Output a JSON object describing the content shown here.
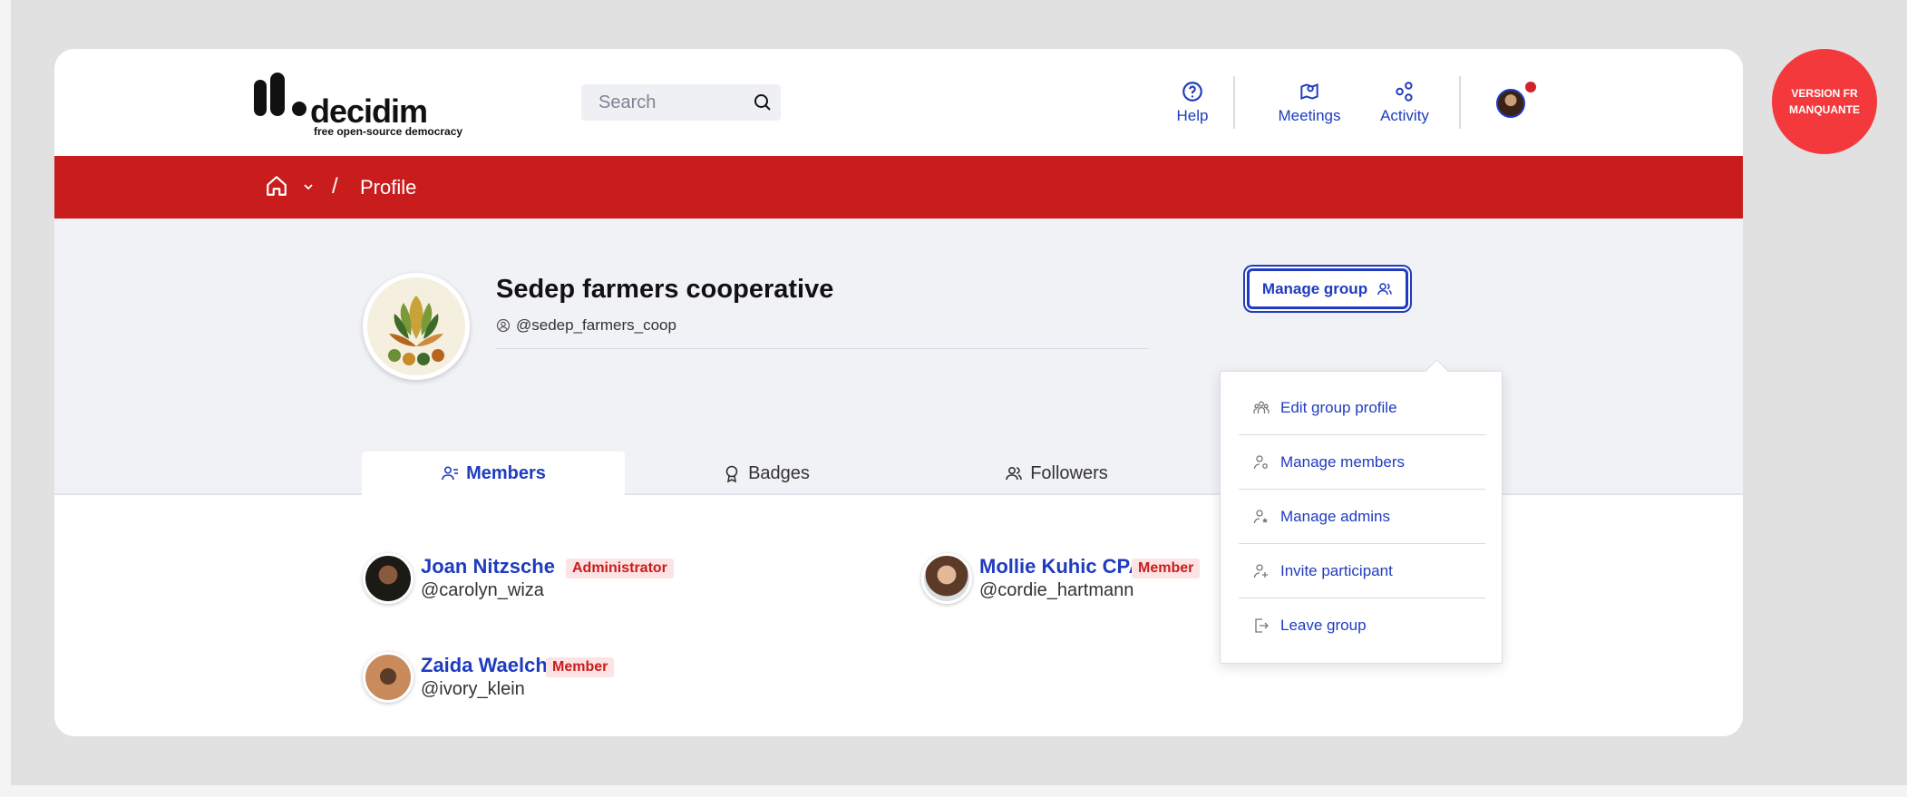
{
  "header": {
    "logo_word": "decidim",
    "logo_tagline": "free open-source democracy",
    "search_placeholder": "Search",
    "nav": [
      {
        "label": "Help",
        "icon": "help-circle-icon"
      },
      {
        "label": "Meetings",
        "icon": "map-pin-icon"
      },
      {
        "label": "Activity",
        "icon": "activity-icon"
      }
    ]
  },
  "breadcrumb": {
    "separator": "/",
    "current": "Profile"
  },
  "profile": {
    "name": "Sedep farmers cooperative",
    "nickname": "@sedep_farmers_coop",
    "manage_button": "Manage group"
  },
  "tabs": [
    {
      "label": "Members",
      "active": true
    },
    {
      "label": "Badges",
      "active": false
    },
    {
      "label": "Followers",
      "active": false
    }
  ],
  "members": [
    {
      "name": "Joan Nitzsche",
      "role": "Administrator",
      "nickname": "@carolyn_wiza"
    },
    {
      "name": "Mollie Kuhic CPA",
      "role": "Member",
      "nickname": "@cordie_hartmann"
    },
    {
      "name": "Zaida Waelchi",
      "role": "Member",
      "nickname": "@ivory_klein"
    }
  ],
  "manage_menu": [
    {
      "label": "Edit group profile",
      "icon": "group-edit-icon"
    },
    {
      "label": "Manage members",
      "icon": "user-settings-icon"
    },
    {
      "label": "Manage admins",
      "icon": "user-star-icon"
    },
    {
      "label": "Invite participant",
      "icon": "user-add-icon"
    },
    {
      "label": "Leave group",
      "icon": "logout-icon"
    }
  ],
  "version_badge": {
    "line1": "VERSION FR",
    "line2": "MANQUANTE"
  },
  "colors": {
    "primary": "#1f3bbf",
    "brand_red": "#c91c1c",
    "badge_bg": "#fde3e3",
    "version_badge": "#f4393d"
  }
}
